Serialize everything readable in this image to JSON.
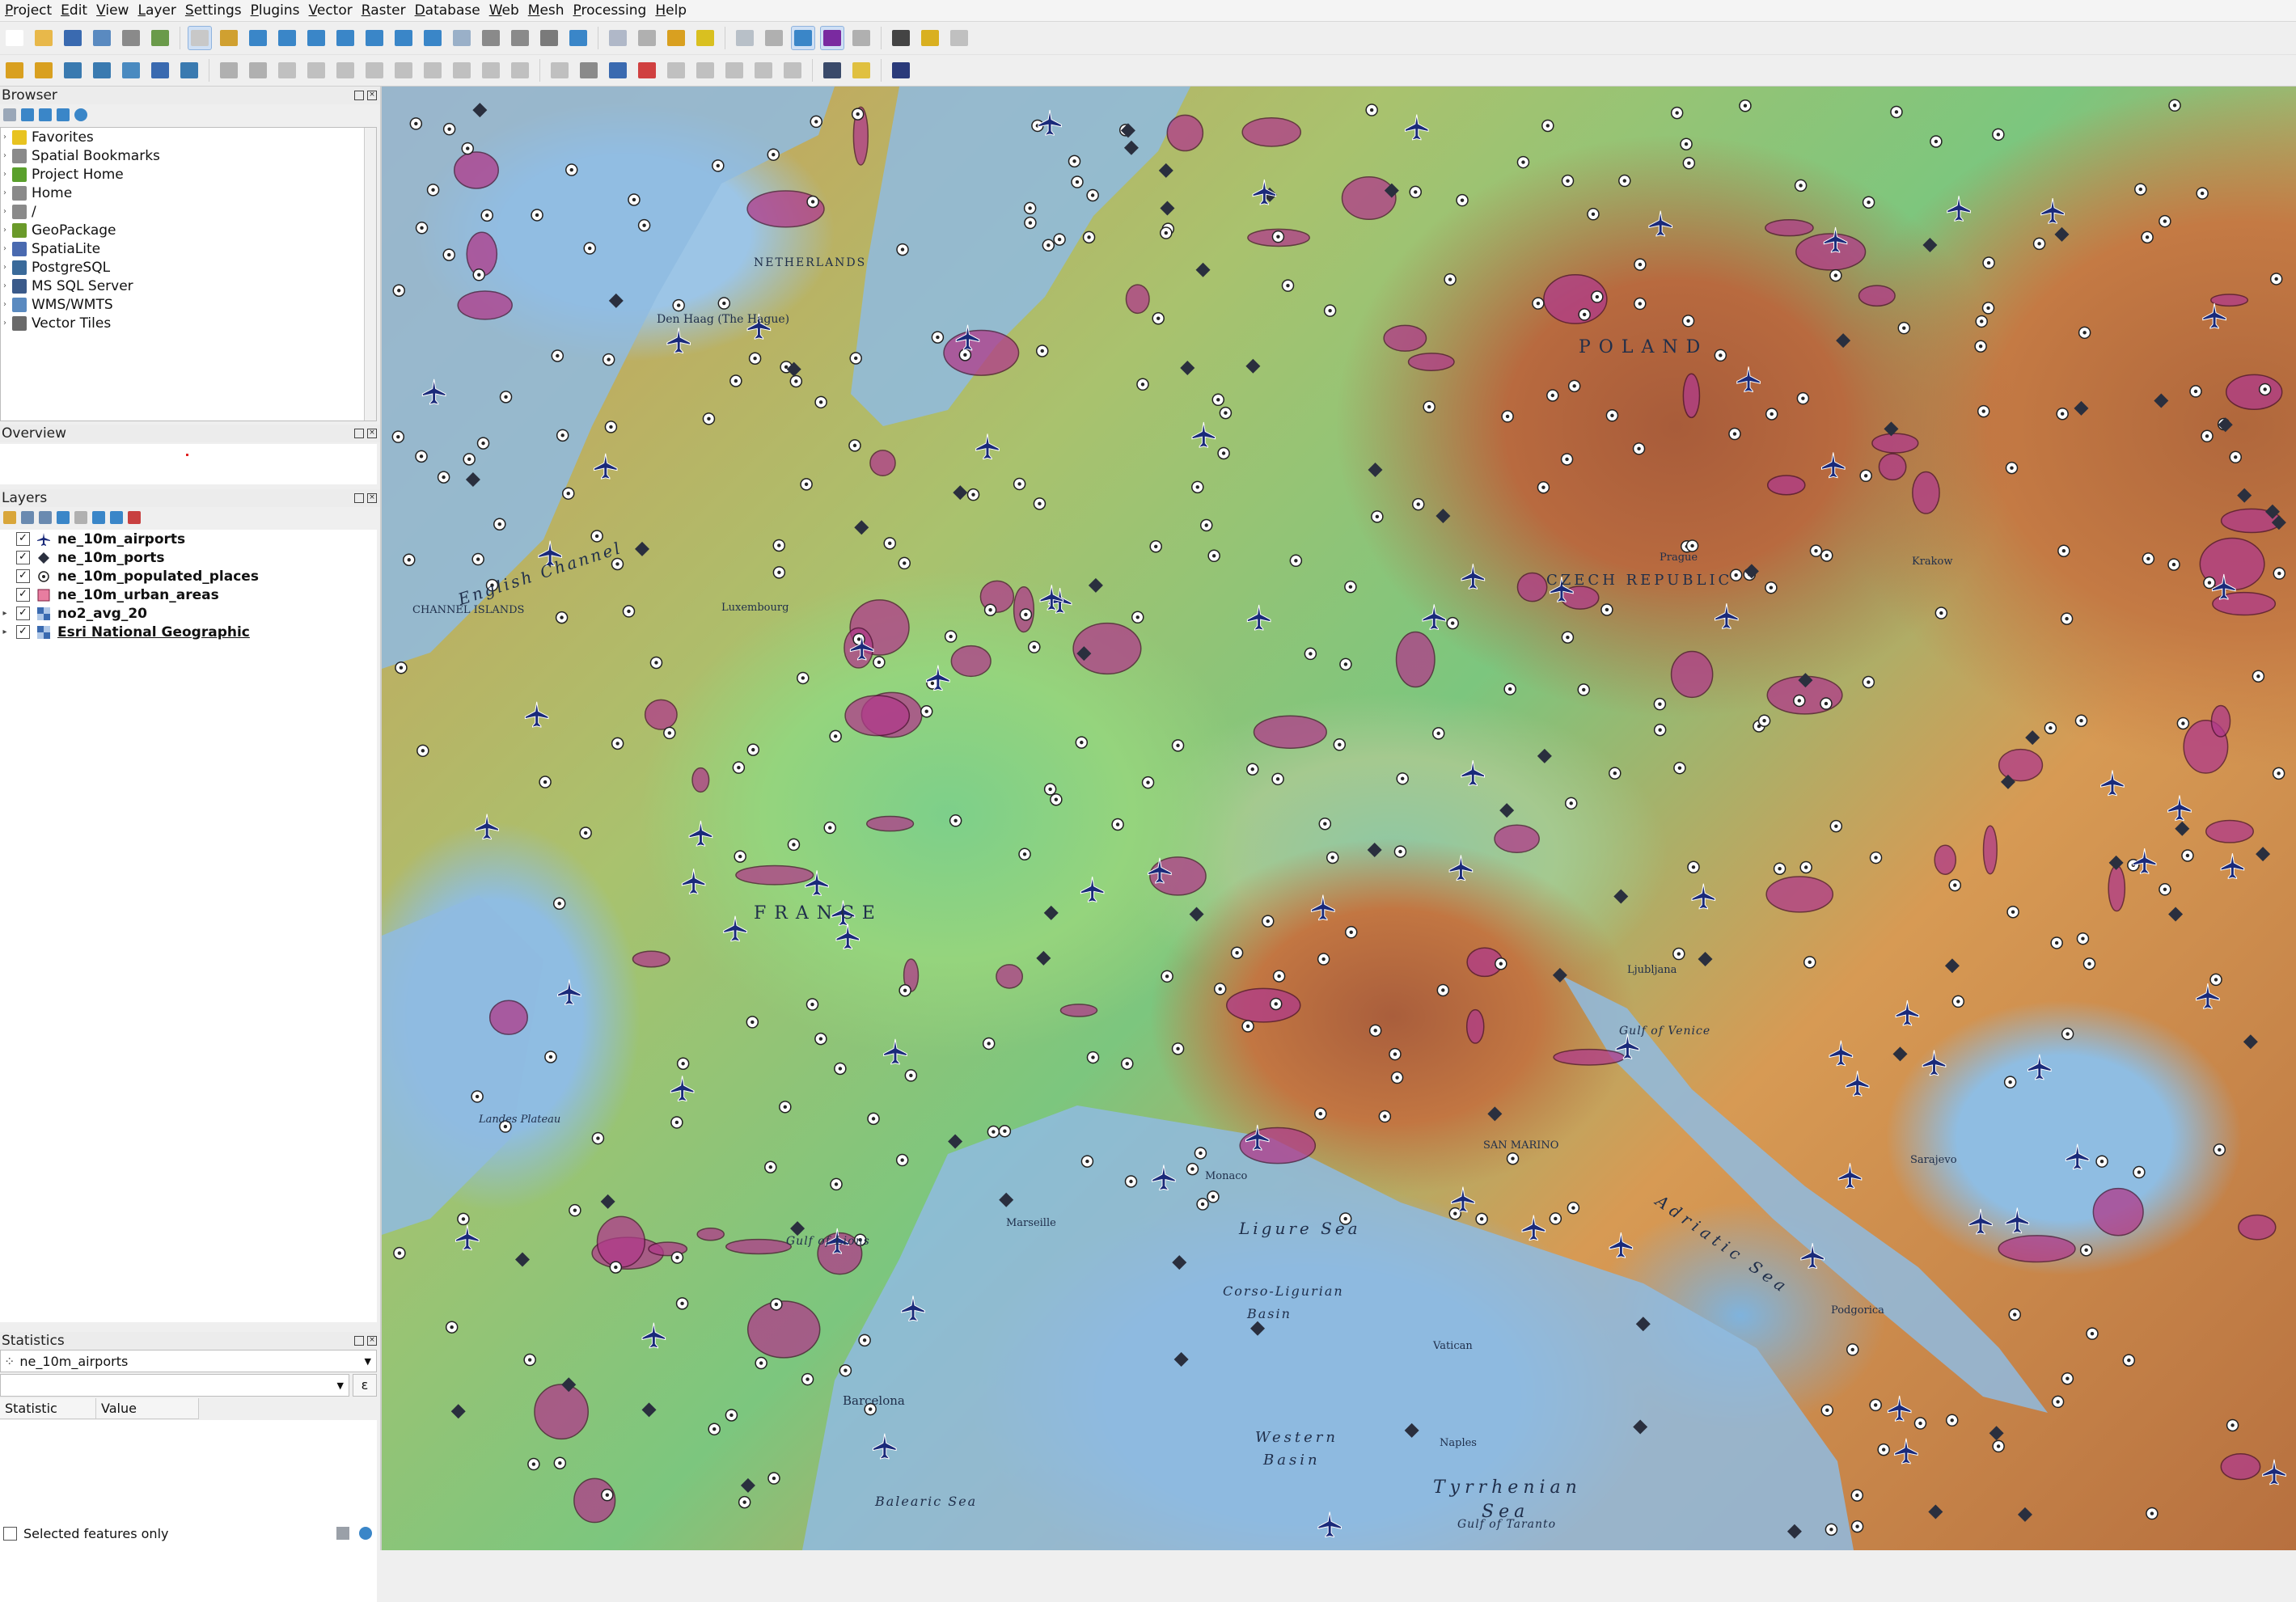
{
  "menu": [
    "Project",
    "Edit",
    "View",
    "Layer",
    "Settings",
    "Plugins",
    "Vector",
    "Raster",
    "Database",
    "Web",
    "Mesh",
    "Processing",
    "Help"
  ],
  "panels": {
    "browser": {
      "title": "Browser",
      "items": [
        {
          "label": "Favorites",
          "icon": "star-icon",
          "color": "#e8c320"
        },
        {
          "label": "Spatial Bookmarks",
          "icon": "bookmark-icon",
          "color": "#8a8a8a"
        },
        {
          "label": "Project Home",
          "icon": "folder-icon",
          "color": "#5aa02c"
        },
        {
          "label": "Home",
          "icon": "home-icon",
          "color": "#8a8a8a"
        },
        {
          "label": "/",
          "icon": "folder-icon",
          "color": "#8a8a8a"
        },
        {
          "label": "GeoPackage",
          "icon": "geopackage-icon",
          "color": "#6a9a2a"
        },
        {
          "label": "SpatiaLite",
          "icon": "spatialite-icon",
          "color": "#4a6ab0"
        },
        {
          "label": "PostgreSQL",
          "icon": "postgresql-icon",
          "color": "#3a6a9a"
        },
        {
          "label": "MS SQL Server",
          "icon": "mssql-icon",
          "color": "#3a5a8a"
        },
        {
          "label": "WMS/WMTS",
          "icon": "globe-icon",
          "color": "#5a8ac0"
        },
        {
          "label": "Vector Tiles",
          "icon": "grid-icon",
          "color": "#6a6a6a"
        }
      ]
    },
    "overview": {
      "title": "Overview"
    },
    "layers": {
      "title": "Layers",
      "items": [
        {
          "label": "ne_10m_airports",
          "icon": "airplane-icon",
          "checked": true,
          "expandable": false
        },
        {
          "label": "ne_10m_ports",
          "icon": "diamond-icon",
          "checked": true,
          "expandable": false
        },
        {
          "label": "ne_10m_populated_places",
          "icon": "point-icon",
          "checked": true,
          "expandable": false
        },
        {
          "label": "ne_10m_urban_areas",
          "icon": "polygon-icon",
          "checked": true,
          "expandable": false
        },
        {
          "label": "no2_avg_20",
          "icon": "raster-icon",
          "checked": true,
          "expandable": true
        },
        {
          "label": "Esri National Geographic",
          "icon": "raster-icon",
          "checked": true,
          "expandable": true
        }
      ]
    },
    "statistics": {
      "title": "Statistics",
      "layer_select": "ne_10m_airports",
      "columns": [
        "Statistic",
        "Value"
      ],
      "selected_only_label": "Selected features only"
    }
  },
  "map_labels": [
    {
      "text": "English Channel",
      "size": 20,
      "italic": true,
      "rotate": -18,
      "spacing": 3
    },
    {
      "text": "FRANCE",
      "size": 22,
      "italic": false,
      "rotate": 0,
      "spacing": 10
    },
    {
      "text": "Ligure Sea",
      "size": 20,
      "italic": true,
      "rotate": 0,
      "spacing": 4
    },
    {
      "text": "Corso-Ligurian",
      "size": 16,
      "italic": true,
      "rotate": 0,
      "spacing": 2
    },
    {
      "text": "Basin",
      "size": 16,
      "italic": true,
      "rotate": 0,
      "spacing": 2
    },
    {
      "text": "Western",
      "size": 18,
      "italic": true,
      "rotate": 0,
      "spacing": 4
    },
    {
      "text": "Basin",
      "size": 18,
      "italic": true,
      "rotate": 0,
      "spacing": 4
    },
    {
      "text": "Tyrrhenian",
      "size": 22,
      "italic": true,
      "rotate": 0,
      "spacing": 6
    },
    {
      "text": "Sea",
      "size": 22,
      "italic": true,
      "rotate": 0,
      "spacing": 6
    },
    {
      "text": "Adriatic Sea",
      "size": 20,
      "italic": true,
      "rotate": 35,
      "spacing": 6
    },
    {
      "text": "Gulf of Venice",
      "size": 14,
      "italic": true,
      "rotate": 0,
      "spacing": 1
    },
    {
      "text": "POLAND",
      "size": 22,
      "italic": false,
      "rotate": 0,
      "spacing": 10
    },
    {
      "text": "CZECH REPUBLIC",
      "size": 18,
      "italic": false,
      "rotate": 0,
      "spacing": 4
    },
    {
      "text": "NETHERLANDS",
      "size": 14,
      "italic": false,
      "rotate": 0,
      "spacing": 2
    },
    {
      "text": "Den Haag (The Hague)",
      "size": 14,
      "italic": false,
      "rotate": 0,
      "spacing": 0
    },
    {
      "text": "CHANNEL ISLANDS",
      "size": 13,
      "italic": false,
      "rotate": 0,
      "spacing": 0
    },
    {
      "text": "Gulf of Lions",
      "size": 14,
      "italic": true,
      "rotate": 0,
      "spacing": 1
    },
    {
      "text": "Balearic Sea",
      "size": 16,
      "italic": true,
      "rotate": 0,
      "spacing": 2
    },
    {
      "text": "Landes Plateau",
      "size": 13,
      "italic": true,
      "rotate": 0,
      "spacing": 0
    },
    {
      "text": "Barcelona",
      "size": 15,
      "italic": false,
      "rotate": 0,
      "spacing": 0
    },
    {
      "text": "Monaco",
      "size": 13,
      "italic": false,
      "rotate": 0,
      "spacing": 0
    },
    {
      "text": "Marseille",
      "size": 13,
      "italic": false,
      "rotate": 0,
      "spacing": 0
    },
    {
      "text": "Luxembourg",
      "size": 13,
      "italic": false,
      "rotate": 0,
      "spacing": 0
    },
    {
      "text": "Prague",
      "size": 13,
      "italic": false,
      "rotate": 0,
      "spacing": 0
    },
    {
      "text": "Krakow",
      "size": 13,
      "italic": false,
      "rotate": 0,
      "spacing": 0
    },
    {
      "text": "Sarajevo",
      "size": 13,
      "italic": false,
      "rotate": 0,
      "spacing": 0
    },
    {
      "text": "Ljubljana",
      "size": 13,
      "italic": false,
      "rotate": 0,
      "spacing": 0
    },
    {
      "text": "SAN MARINO",
      "size": 13,
      "italic": false,
      "rotate": 0,
      "spacing": 0
    },
    {
      "text": "Vatican",
      "size": 13,
      "italic": false,
      "rotate": 0,
      "spacing": 0
    },
    {
      "text": "Naples",
      "size": 13,
      "italic": false,
      "rotate": 0,
      "spacing": 0
    },
    {
      "text": "Gulf of Taranto",
      "size": 14,
      "italic": true,
      "rotate": 0,
      "spacing": 1
    },
    {
      "text": "Podgorica",
      "size": 13,
      "italic": false,
      "rotate": 0,
      "spacing": 0
    }
  ]
}
